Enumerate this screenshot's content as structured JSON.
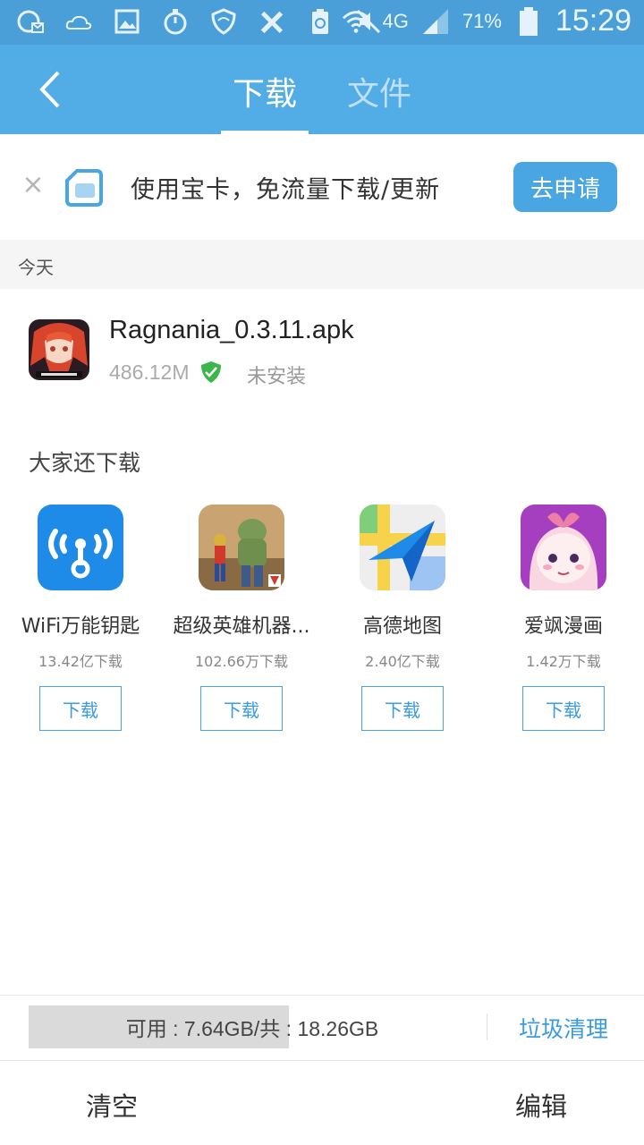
{
  "status_bar": {
    "battery": "71%",
    "network": "4G",
    "time": "15:29",
    "icons": [
      "add-contact-icon",
      "weather-icon",
      "gallery-icon",
      "timer-icon",
      "shield-icon",
      "tools-icon",
      "battery-saver-icon",
      "mute-icon",
      "wifi-icon",
      "signal-icon",
      "battery-icon"
    ]
  },
  "header": {
    "tabs": [
      {
        "label": "下载",
        "active": true
      },
      {
        "label": "文件",
        "active": false
      }
    ],
    "accent_color": "#52ace6"
  },
  "promo": {
    "text": "使用宝卡，免流量下载/更新",
    "button_label": "去申请"
  },
  "section": {
    "label": "今天"
  },
  "download_item": {
    "name": "Ragnania_0.3.11.apk",
    "size": "486.12M",
    "status": "未安装",
    "verified": true
  },
  "recommend": {
    "title": "大家还下载",
    "apps": [
      {
        "name": "WiFi万能钥匙",
        "count": "13.42亿下载",
        "button": "下载",
        "icon": "wifi-key-icon"
      },
      {
        "name": "超级英雄机器...",
        "count": "102.66万下载",
        "button": "下载",
        "icon": "superhero-game-icon"
      },
      {
        "name": "高德地图",
        "count": "2.40亿下载",
        "button": "下载",
        "icon": "amap-icon"
      },
      {
        "name": "爱飒漫画",
        "count": "1.42万下载",
        "button": "下载",
        "icon": "manga-icon"
      }
    ]
  },
  "storage": {
    "text": "可用 : 7.64GB/共 : 18.26GB",
    "used_fraction": 0.582,
    "cleanup_label": "垃圾清理"
  },
  "bottom": {
    "clear_label": "清空",
    "edit_label": "编辑"
  }
}
